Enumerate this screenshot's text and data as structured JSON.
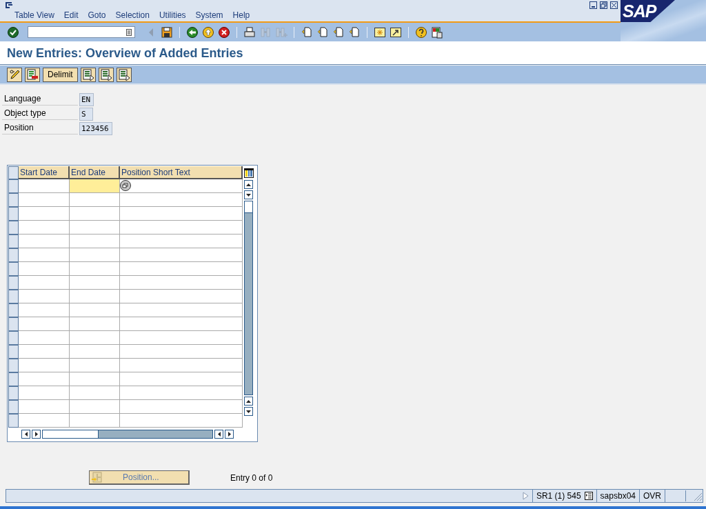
{
  "menu": [
    "Table View",
    "Edit",
    "Goto",
    "Selection",
    "Utilities",
    "System",
    "Help"
  ],
  "logo": "SAP",
  "toolbar": [
    {
      "kind": "check",
      "disabled": false
    },
    {
      "kind": "command-field",
      "disabled": false
    },
    {
      "kind": "triangle-left",
      "disabled": true
    },
    {
      "kind": "save",
      "disabled": false
    },
    {
      "kind": "sep"
    },
    {
      "kind": "back",
      "disabled": false
    },
    {
      "kind": "exit",
      "disabled": false
    },
    {
      "kind": "cancel",
      "disabled": false
    },
    {
      "kind": "sep"
    },
    {
      "kind": "print",
      "disabled": false
    },
    {
      "kind": "find",
      "disabled": true
    },
    {
      "kind": "find-next",
      "disabled": true
    },
    {
      "kind": "sep"
    },
    {
      "kind": "page",
      "disabled": false
    },
    {
      "kind": "page",
      "disabled": false
    },
    {
      "kind": "page",
      "disabled": false
    },
    {
      "kind": "page",
      "disabled": false
    },
    {
      "kind": "sep"
    },
    {
      "kind": "new-session",
      "disabled": false
    },
    {
      "kind": "shortcut",
      "disabled": false
    },
    {
      "kind": "sep"
    },
    {
      "kind": "help",
      "disabled": false
    },
    {
      "kind": "layout",
      "disabled": false
    }
  ],
  "title": "New Entries: Overview of Added Entries",
  "app_toolbar": [
    {
      "kind": "edit-icon"
    },
    {
      "kind": "delete-icon"
    },
    {
      "kind": "text",
      "label": "Delimit"
    },
    {
      "kind": "list-icon"
    },
    {
      "kind": "list-icon"
    },
    {
      "kind": "list-icon"
    }
  ],
  "fields": [
    {
      "label": "Language",
      "value": "EN"
    },
    {
      "label": "Object type",
      "value": "S"
    },
    {
      "label": "Position",
      "value": "123456"
    }
  ],
  "table": {
    "columns": [
      "Start Date",
      "End Date",
      "Position Short Text"
    ],
    "rows": [
      {
        "end_date_highlighted": true
      },
      {
        "end_date_highlighted": false
      },
      {
        "end_date_highlighted": false
      },
      {
        "end_date_highlighted": false
      },
      {
        "end_date_highlighted": false
      },
      {
        "end_date_highlighted": false
      },
      {
        "end_date_highlighted": false
      },
      {
        "end_date_highlighted": false
      },
      {
        "end_date_highlighted": false
      },
      {
        "end_date_highlighted": false
      },
      {
        "end_date_highlighted": false
      },
      {
        "end_date_highlighted": false
      },
      {
        "end_date_highlighted": false
      },
      {
        "end_date_highlighted": false
      },
      {
        "end_date_highlighted": false
      },
      {
        "end_date_highlighted": false
      },
      {
        "end_date_highlighted": false
      },
      {
        "end_date_highlighted": false
      }
    ]
  },
  "position_button": "Position...",
  "entry_count": "Entry 0 of 0",
  "status_bar": {
    "system": "SR1 (1) 545",
    "server": "sapsbx04",
    "mode": "OVR"
  }
}
